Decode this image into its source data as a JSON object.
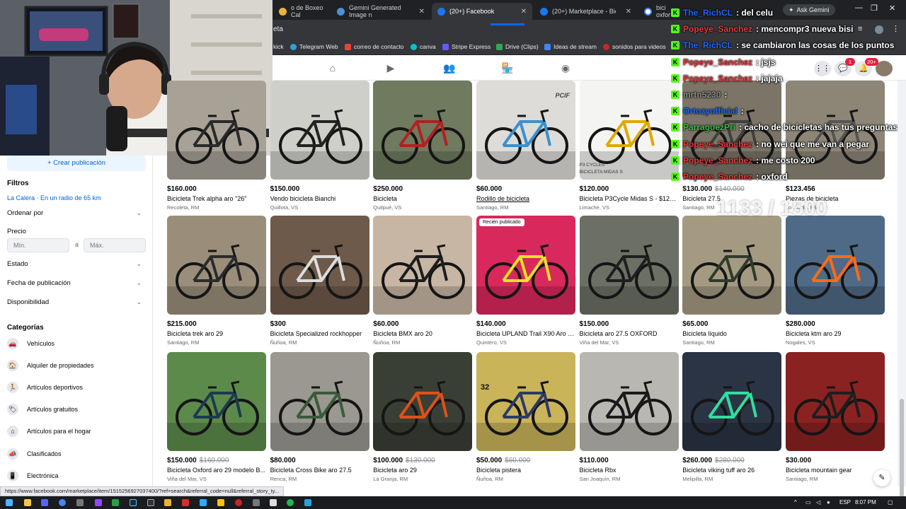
{
  "browser": {
    "tabs": [
      {
        "label": "o de Boxeo Cal",
        "color": "#e8b339",
        "active": false
      },
      {
        "label": "Gemini Generated Image n",
        "color": "#4a90d9",
        "active": false
      },
      {
        "label": "(20+) Facebook",
        "color": "#1877f2",
        "active": true
      },
      {
        "label": "(20+) Marketplace - Biciclet",
        "color": "#1877f2",
        "active": false
      },
      {
        "label": "bici oxfor",
        "color": "#ffffff",
        "active": false
      }
    ],
    "ask_gemini": "Ask Gemini",
    "address_fragment": "eta",
    "bookmarks": [
      {
        "label": "kick",
        "color": "#53fc18"
      },
      {
        "label": "Telegram Web",
        "color": "#2aa1da"
      },
      {
        "label": "correo de contacto",
        "color": "#ea4335"
      },
      {
        "label": "canva",
        "color": "#00c4cc"
      },
      {
        "label": "Stripe Express",
        "color": "#635bff"
      },
      {
        "label": "Drive (Clips)",
        "color": "#34a853"
      },
      {
        "label": "Ideas de stream",
        "color": "#4285f4"
      },
      {
        "label": "sonidos para videos",
        "color": "#c62828"
      }
    ]
  },
  "header": {
    "notifications_badge": "1",
    "messages_badge": "20+"
  },
  "sidebar": {
    "create_label": "+ Crear publicación",
    "filters_title": "Filtros",
    "location": "La Calera · En un radio de 65 km",
    "sort_label": "Ordenar por",
    "price_label": "Precio",
    "price_min_placeholder": "Mín.",
    "price_sep": "a",
    "price_max_placeholder": "Máx.",
    "state_label": "Estado",
    "date_label": "Fecha de publicación",
    "availability_label": "Disponibilidad",
    "categories_title": "Categorías",
    "categories": [
      {
        "label": "Vehículos",
        "icon": "car-icon"
      },
      {
        "label": "Alquiler de propiedades",
        "icon": "house-icon"
      },
      {
        "label": "Artículos deportivos",
        "icon": "runner-icon"
      },
      {
        "label": "Artículos gratuitos",
        "icon": "tag-icon"
      },
      {
        "label": "Artículos para el hogar",
        "icon": "home-icon"
      },
      {
        "label": "Clasificados",
        "icon": "megaphone-icon"
      },
      {
        "label": "Electrónica",
        "icon": "phone-icon"
      }
    ]
  },
  "listings": [
    {
      "price": "$160.000",
      "old": "",
      "title": "Bicicleta Trek alpha aro \"26\"",
      "loc": "Recoleta, RM",
      "bg": "#a8a296",
      "frame": "#2a2a2a"
    },
    {
      "price": "$150.000",
      "old": "",
      "title": "Vendo bicicleta Bianchi",
      "loc": "Quillota, VS",
      "bg": "#cfcfca",
      "frame": "#222222"
    },
    {
      "price": "$250.000",
      "old": "",
      "title": "Bicicleta",
      "loc": "Quilpué, VS",
      "bg": "#6f7a5e",
      "frame": "#b32020"
    },
    {
      "price": "$60.000",
      "old": "",
      "title": "Rodillo de bicicleta",
      "loc": "Santiago, RM",
      "bg": "#dedcd8",
      "frame": "#3a8fd0",
      "link": true
    },
    {
      "price": "$120.000",
      "old": "",
      "title": "Bicicleta P3Cycle Midas S - $120...",
      "loc": "Limache, VS",
      "bg": "#f4f4f2",
      "frame": "#e0a800"
    },
    {
      "price": "$130.000",
      "old": "$140.000",
      "title": "Bicicleta 27.5",
      "loc": "Santiago, RM",
      "bg": "#7b7467",
      "frame": "#404040"
    },
    {
      "price": "$123.456",
      "old": "",
      "title": "Piezas de bicicleta",
      "loc": "Lo Prado, RM",
      "bg": "#8d8677",
      "frame": "#555555"
    },
    {
      "price": "$215.000",
      "old": "",
      "title": "Bicicleta trek aro 29",
      "loc": "Santiago, RM",
      "bg": "#9a8e7b",
      "frame": "#2b2b2b"
    },
    {
      "price": "$300",
      "old": "",
      "title": "Bicicleta Specialized rockhopper",
      "loc": "Ñuñoa, RM",
      "bg": "#6e5a4a",
      "frame": "#dddddd"
    },
    {
      "price": "$60.000",
      "old": "",
      "title": "Bicicleta BMX aro 20",
      "loc": "Ñuñoa, RM",
      "bg": "#c7b6a3",
      "frame": "#1e1e1e"
    },
    {
      "price": "$140.000",
      "old": "",
      "title": "Bicicleta UPLAND Trail X90 Aro 27...",
      "loc": "Quintero, VS",
      "bg": "#d9285c",
      "frame": "#e8e22a",
      "tag": "Recién publicado"
    },
    {
      "price": "$150.000",
      "old": "",
      "title": "Bicicleta aro 27.5 OXFORD",
      "loc": "Viña del Mar, VS",
      "bg": "#6c6f64",
      "frame": "#1f1f1f"
    },
    {
      "price": "$65.000",
      "old": "",
      "title": "Bicicleta líquido",
      "loc": "Santiago, RM",
      "bg": "#a49a82",
      "frame": "#2f3a2a"
    },
    {
      "price": "$280.000",
      "old": "",
      "title": "Bicicleta ktm aro 29",
      "loc": "Nogales, VS",
      "bg": "#4f6a86",
      "frame": "#ff6a1a"
    },
    {
      "price": "$150.000",
      "old": "$160.000",
      "title": "Bicicleta Oxford aro 29 modelo B...",
      "loc": "Viña del Mar, VS",
      "bg": "#5c8a4a",
      "frame": "#1b3b4f"
    },
    {
      "price": "$80.000",
      "old": "",
      "title": "Bicicleta Cross Bike aro 27.5",
      "loc": "Renca, RM",
      "bg": "#9a9890",
      "frame": "#3a5a3a"
    },
    {
      "price": "$100.000",
      "old": "$130.000",
      "title": "Bicicleta aro 29",
      "loc": "La Granja, RM",
      "bg": "#3a3f35",
      "frame": "#e0501a"
    },
    {
      "price": "$50.000",
      "old": "$60.000",
      "title": "Bicicleta pistera",
      "loc": "Ñuñoa, RM",
      "bg": "#c9b45a",
      "frame": "#2c3a66"
    },
    {
      "price": "$110.000",
      "old": "",
      "title": "Bicicleta Rbx",
      "loc": "San Joaquín, RM",
      "bg": "#b9b7b1",
      "frame": "#1a1a1a"
    },
    {
      "price": "$260.000",
      "old": "$280.000",
      "title": "Bicicleta viking tuff aro 26",
      "loc": "Melipilla, RM",
      "bg": "#2a3444",
      "frame": "#2ee0a0"
    },
    {
      "price": "$30.000",
      "old": "",
      "title": "Bicicleta mountain gear",
      "loc": "Santiago, RM",
      "bg": "#8a2222",
      "frame": "#1f1f1f"
    }
  ],
  "photo_overlays": {
    "card3_brand": "PCIF",
    "card4_brand": "P3 CYCLES",
    "card4_model": "BICICLETA MIDAS S",
    "card17_number": "32"
  },
  "chat": [
    {
      "user": "The_RichCL",
      "text": ": del celu",
      "color": "#1e66ff"
    },
    {
      "user": "Popeye_Sanchez",
      "text": ": mencompr3 nueva bisi",
      "color": "#e23b3b"
    },
    {
      "user": "The_RichCL",
      "text": ": se cambiaron las cosas de los puntos",
      "color": "#1e66ff"
    },
    {
      "user": "Popeye_Sanchez",
      "text": ": jsjs",
      "color": "#e23b3b"
    },
    {
      "user": "Popeye_Sanchez",
      "text": ": jajaja",
      "color": "#e23b3b"
    },
    {
      "user": "mrtn5230",
      "text": ":",
      "color": "#8a8a8a"
    },
    {
      "user": "Ortozyofficial",
      "text": ":",
      "color": "#1e66ff"
    },
    {
      "user": "ParraguezPri",
      "text": ": cacho de bicicletas has tus preguntas",
      "color": "#3fb84f"
    },
    {
      "user": "Popeye_Sanchez",
      "text": ": no wei que me van a pegar",
      "color": "#e23b3b"
    },
    {
      "user": "Popeye_Sanchez",
      "text": ": me costo 200",
      "color": "#e23b3b"
    },
    {
      "user": "Popeye_Sanchez",
      "text": ": oxford",
      "color": "#e23b3b"
    }
  ],
  "goal": "1133 / 1500",
  "status_url": "https://www.facebook.com/marketplace/item/1515256927037400/?ref=search&referral_code=null&referral_story_ty...",
  "taskbar": {
    "lang": "ESP",
    "time": "8:07 PM"
  }
}
